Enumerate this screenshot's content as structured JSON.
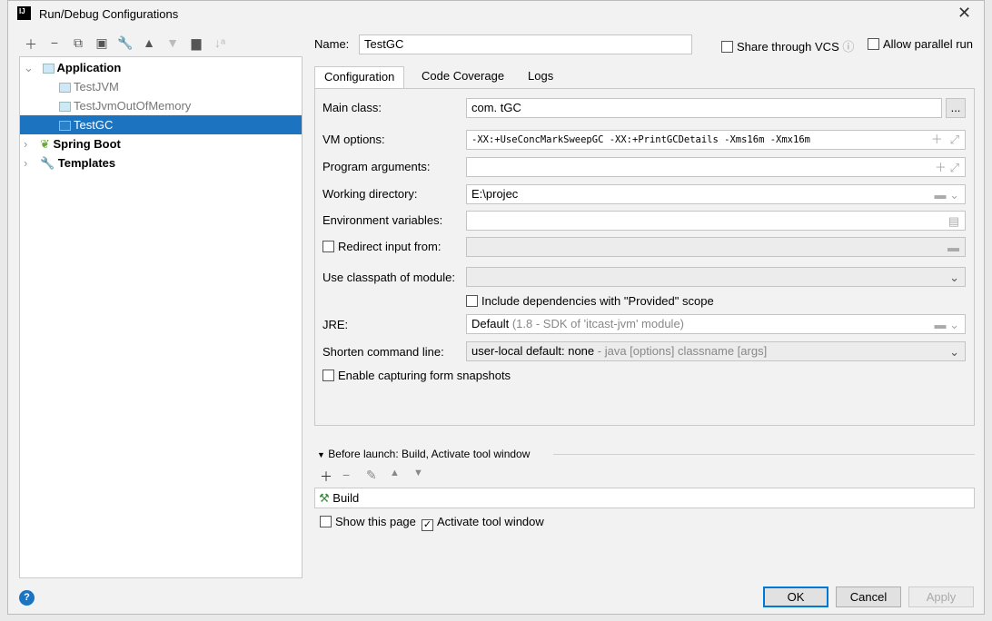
{
  "window": {
    "title": "Run/Debug Configurations",
    "logo": "IJ"
  },
  "toolbar": {
    "icons": [
      "plus-icon",
      "minus-icon",
      "copy-icon",
      "save-icon",
      "wrench-icon",
      "arrow-up-icon",
      "arrow-down-icon",
      "folder-add-icon",
      "sort-icon"
    ]
  },
  "tree": {
    "items": [
      {
        "label": "Application",
        "level": 0,
        "expanded": true,
        "bold": true
      },
      {
        "label": "TestJVM",
        "level": 1
      },
      {
        "label": "TestJvmOutOfMemory",
        "level": 1
      },
      {
        "label": "TestGC",
        "level": 1,
        "selected": true
      },
      {
        "label": "Spring Boot",
        "level": 0,
        "expanded": false,
        "bold": true
      },
      {
        "label": "Templates",
        "level": 0,
        "expanded": false,
        "bold": true
      }
    ]
  },
  "form": {
    "name_label": "Name:",
    "name_value": "TestGC",
    "share_label": "Share through VCS",
    "parallel_label": "Allow parallel run",
    "tabs": [
      "Configuration",
      "Code Coverage",
      "Logs"
    ],
    "main_class_label": "Main class:",
    "main_class_value": "com.          tGC",
    "vm_label": "VM options:",
    "vm_value": "-XX:+UseConcMarkSweepGC -XX:+PrintGCDetails -Xms16m -Xmx16m",
    "args_label": "Program arguments:",
    "args_value": "",
    "wd_label": "Working directory:",
    "wd_value": "E:\\projec",
    "env_label": "Environment variables:",
    "env_value": "",
    "redirect_label": "Redirect input from:",
    "classpath_label": "Use classpath of module:",
    "include_label": "Include dependencies with \"Provided\" scope",
    "jre_label": "JRE:",
    "jre_value": "Default",
    "jre_hint": "(1.8 - SDK of 'itcast-jvm' module)",
    "shorten_label": "Shorten command line:",
    "shorten_value": "user-local default: none",
    "shorten_hint": "- java [options] classname [args]",
    "snapshots_label": "Enable capturing form snapshots",
    "ellipsis": "..."
  },
  "before_launch": {
    "title": "Before launch: Build, Activate tool window",
    "items": [
      "Build"
    ],
    "show_page_label": "Show this page",
    "show_page_checked": false,
    "activate_label": "Activate tool window",
    "activate_checked": true
  },
  "buttons": {
    "ok": "OK",
    "cancel": "Cancel",
    "apply": "Apply",
    "help": "?"
  },
  "colors": {
    "selection": "#1c74c1",
    "accent": "#0078d7"
  }
}
